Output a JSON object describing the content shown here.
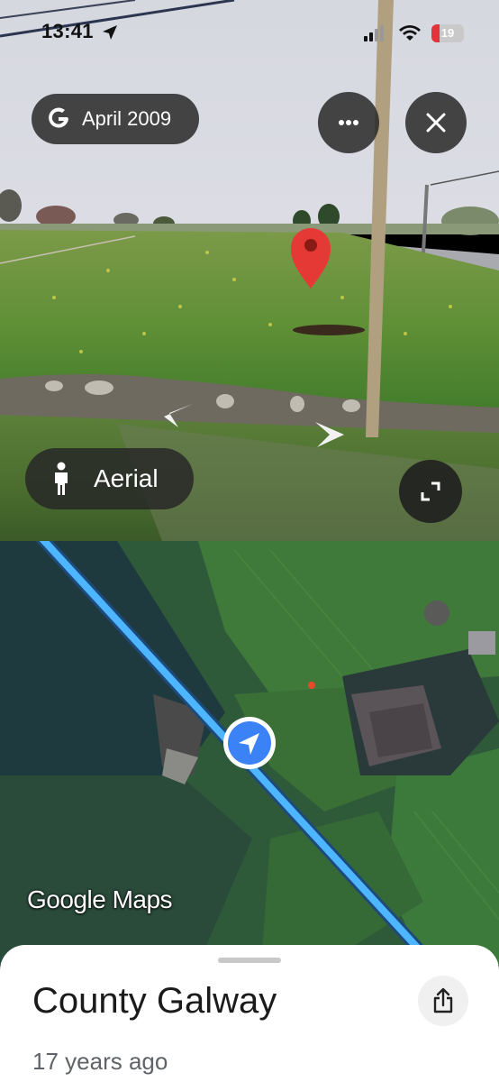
{
  "status_bar": {
    "time": "13:41",
    "battery": "19"
  },
  "street_view": {
    "date_label": "April 2009",
    "mode_label": "Aerial",
    "icons": [
      "google-g-icon",
      "more-icon",
      "close-icon",
      "person-icon",
      "expand-icon",
      "map-pin-icon",
      "nav-arrow-left-icon",
      "nav-arrow-right-icon"
    ]
  },
  "map": {
    "watermark_brand": "Google",
    "watermark_product": "Maps",
    "icons": [
      "location-arrow-icon"
    ],
    "route_color": "#4db6ff"
  },
  "sheet": {
    "place_name": "County Galway",
    "subtitle": "17 years ago",
    "icons": [
      "share-icon"
    ]
  },
  "colors": {
    "pill_bg": "#282828",
    "pin_red": "#e53935",
    "location_blue": "#3b82f6"
  }
}
